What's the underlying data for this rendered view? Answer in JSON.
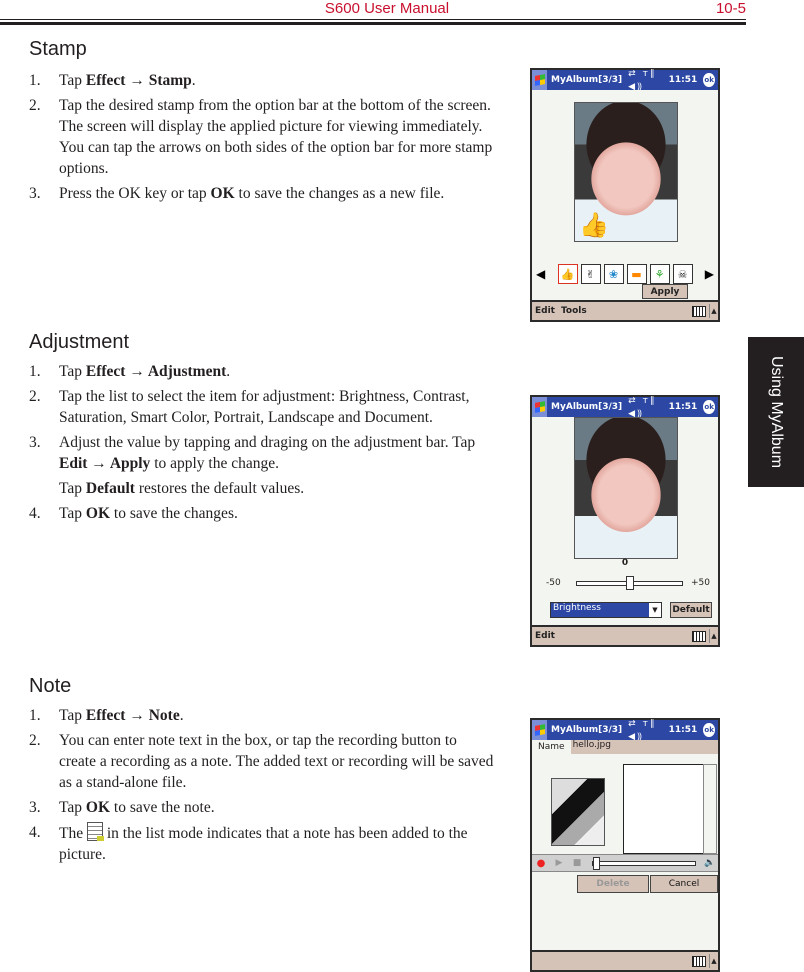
{
  "header": {
    "title": "S600 User Manual",
    "page": "10-5"
  },
  "side_tab": {
    "label": "Using MyAlbum"
  },
  "sections": [
    {
      "title": "Stamp",
      "steps": [
        {
          "num": "1.",
          "parts": [
            {
              "t": "Tap "
            },
            {
              "b": "Effect → Stamp"
            },
            {
              "t": "."
            }
          ]
        },
        {
          "num": "2.",
          "parts": [
            {
              "t": "Tap the desired stamp from the option bar at the bottom of the screen. The screen will display the applied picture for viewing immediately. You can tap the arrows on both sides of the option bar for more stamp options."
            }
          ]
        },
        {
          "num": "3.",
          "parts": [
            {
              "t": "Press the OK key or tap "
            },
            {
              "b": "OK"
            },
            {
              "t": " to save the changes as a new file."
            }
          ]
        }
      ]
    },
    {
      "title": "Adjustment",
      "steps": [
        {
          "num": "1.",
          "parts": [
            {
              "t": "Tap "
            },
            {
              "b": "Effect → Adjustment"
            },
            {
              "t": "."
            }
          ]
        },
        {
          "num": "2.",
          "parts": [
            {
              "t": "Tap the list to select the item for adjustment: Brightness, Contrast, Saturation, Smart Color, Portrait, Landscape and Document."
            }
          ]
        },
        {
          "num": "3.",
          "parts": [
            {
              "t": "Adjust the value by tapping and draging on the adjustment bar. Tap "
            },
            {
              "b": "Edit → Apply"
            },
            {
              "t": " to apply the change."
            }
          ],
          "extra": [
            {
              "t": "Tap "
            },
            {
              "b": "Default"
            },
            {
              "t": " restores the default values."
            }
          ]
        },
        {
          "num": "4.",
          "parts": [
            {
              "t": "Tap "
            },
            {
              "b": "OK"
            },
            {
              "t": " to save the changes."
            }
          ]
        }
      ]
    },
    {
      "title": "Note",
      "steps": [
        {
          "num": "1.",
          "parts": [
            {
              "t": "Tap "
            },
            {
              "b": "Effect → Note"
            },
            {
              "t": "."
            }
          ]
        },
        {
          "num": "2.",
          "parts": [
            {
              "t": "You can enter note text in the box, or tap the recording button to create a recording as a note. The added text or recording will be saved as a stand-alone file."
            }
          ]
        },
        {
          "num": "3.",
          "parts": [
            {
              "t": "Tap "
            },
            {
              "b": "OK"
            },
            {
              "t": " to save the note."
            }
          ]
        },
        {
          "num": "4.",
          "parts": [
            {
              "t": "The "
            },
            {
              "icon": "note-file-icon"
            },
            {
              "t": " in the list mode indicates that a note has been added to the picture."
            }
          ]
        }
      ]
    }
  ],
  "device": {
    "title": "MyAlbum[3/3]",
    "status_icons": "⇄ ᴛ∥ ◀⸩",
    "clock": "11:51",
    "ok": "ok",
    "stamp_screen": {
      "stamps": [
        "👍",
        "✌",
        "❀",
        "▬",
        "⚘",
        "☠"
      ],
      "apply": "Apply",
      "menu": [
        "Edit",
        "Tools"
      ]
    },
    "adjust_screen": {
      "value": "0",
      "min": "-50",
      "max": "+50",
      "slider_fraction": 0.5,
      "select": "Brightness",
      "default_btn": "Default",
      "menu": [
        "Edit"
      ]
    },
    "note_screen": {
      "name_label": "Name",
      "name_value": "hello.jpg",
      "delete_btn": "Delete",
      "cancel_btn": "Cancel"
    }
  }
}
